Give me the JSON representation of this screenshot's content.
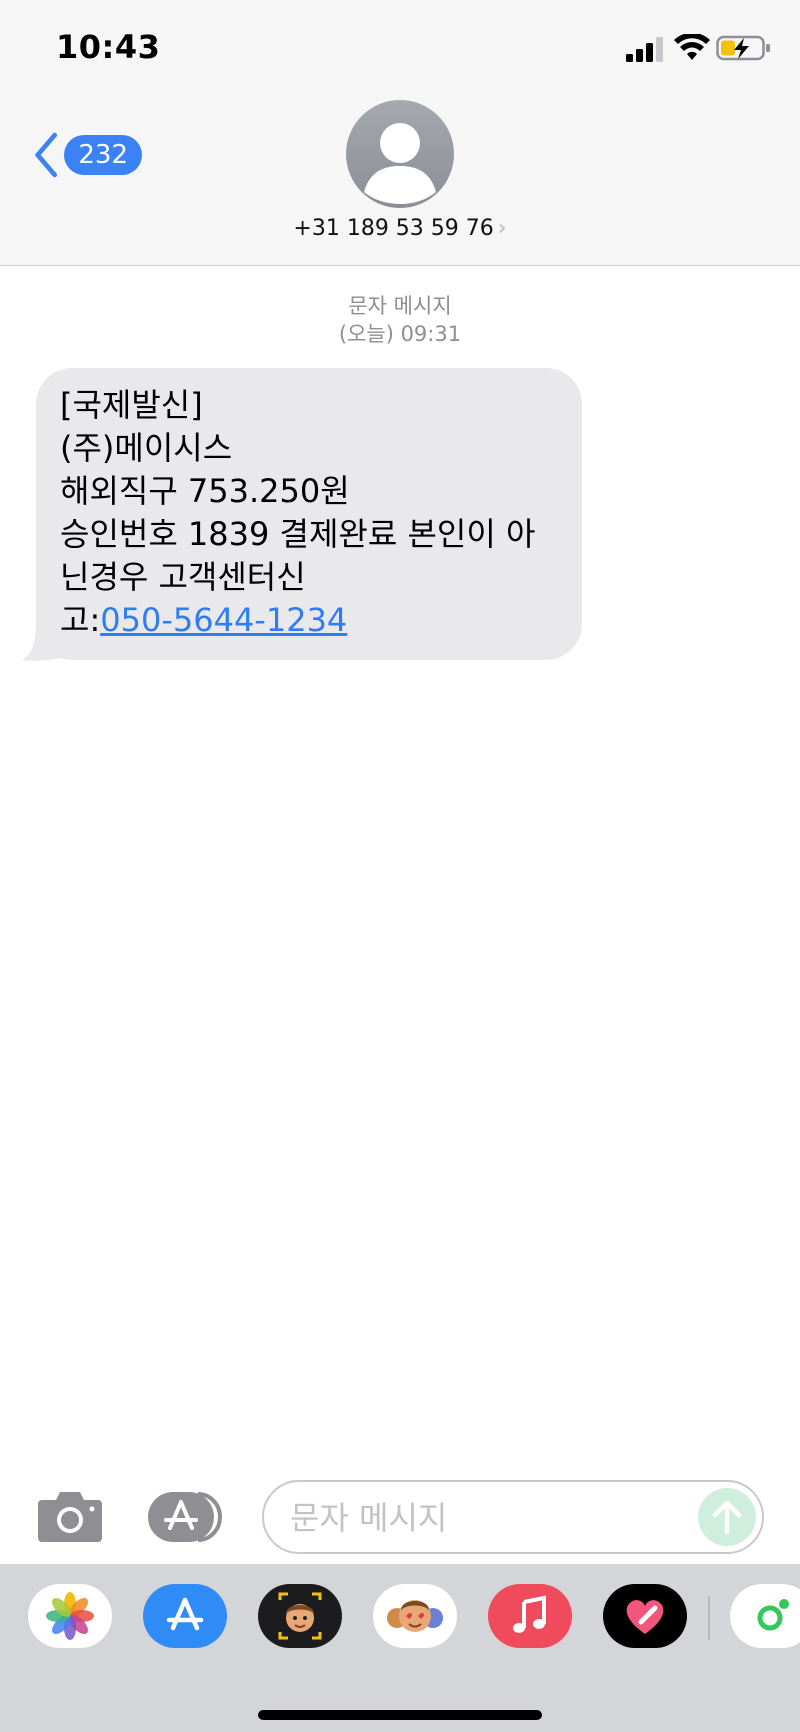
{
  "status_bar": {
    "time": "10:43"
  },
  "nav": {
    "back_count": "232"
  },
  "contact": {
    "number": "+31 189 53 59 76",
    "chevron": "›"
  },
  "conversation": {
    "service": "문자 메시지",
    "timestamp": "(오늘) 09:31"
  },
  "message": {
    "lines": [
      "[국제발신]",
      "(주)메이시스",
      "해외직구 753.250원",
      "승인번호 1839 결제완료 본인이 아",
      "닌경우 고객센터신"
    ],
    "last_prefix": "고:",
    "phone_link": "050-5644-1234"
  },
  "composer": {
    "placeholder": "문자 메시지"
  },
  "colors": {
    "accent": "#3b82f6",
    "link": "#2f7df6",
    "bubble": "#e9e9eb",
    "send_disabled": "#cfeedd"
  },
  "icons": {
    "signal": "signal-icon",
    "wifi": "wifi-icon",
    "battery": "battery-charging-icon",
    "back": "chevron-left-icon",
    "camera": "camera-icon",
    "apps": "app-store-icon",
    "send": "arrow-up-icon"
  },
  "tray_apps": [
    {
      "name": "Photos"
    },
    {
      "name": "App Store"
    },
    {
      "name": "Memoji"
    },
    {
      "name": "Animoji Stickers"
    },
    {
      "name": "Music"
    },
    {
      "name": "Digital Touch"
    },
    {
      "name": "More"
    }
  ]
}
